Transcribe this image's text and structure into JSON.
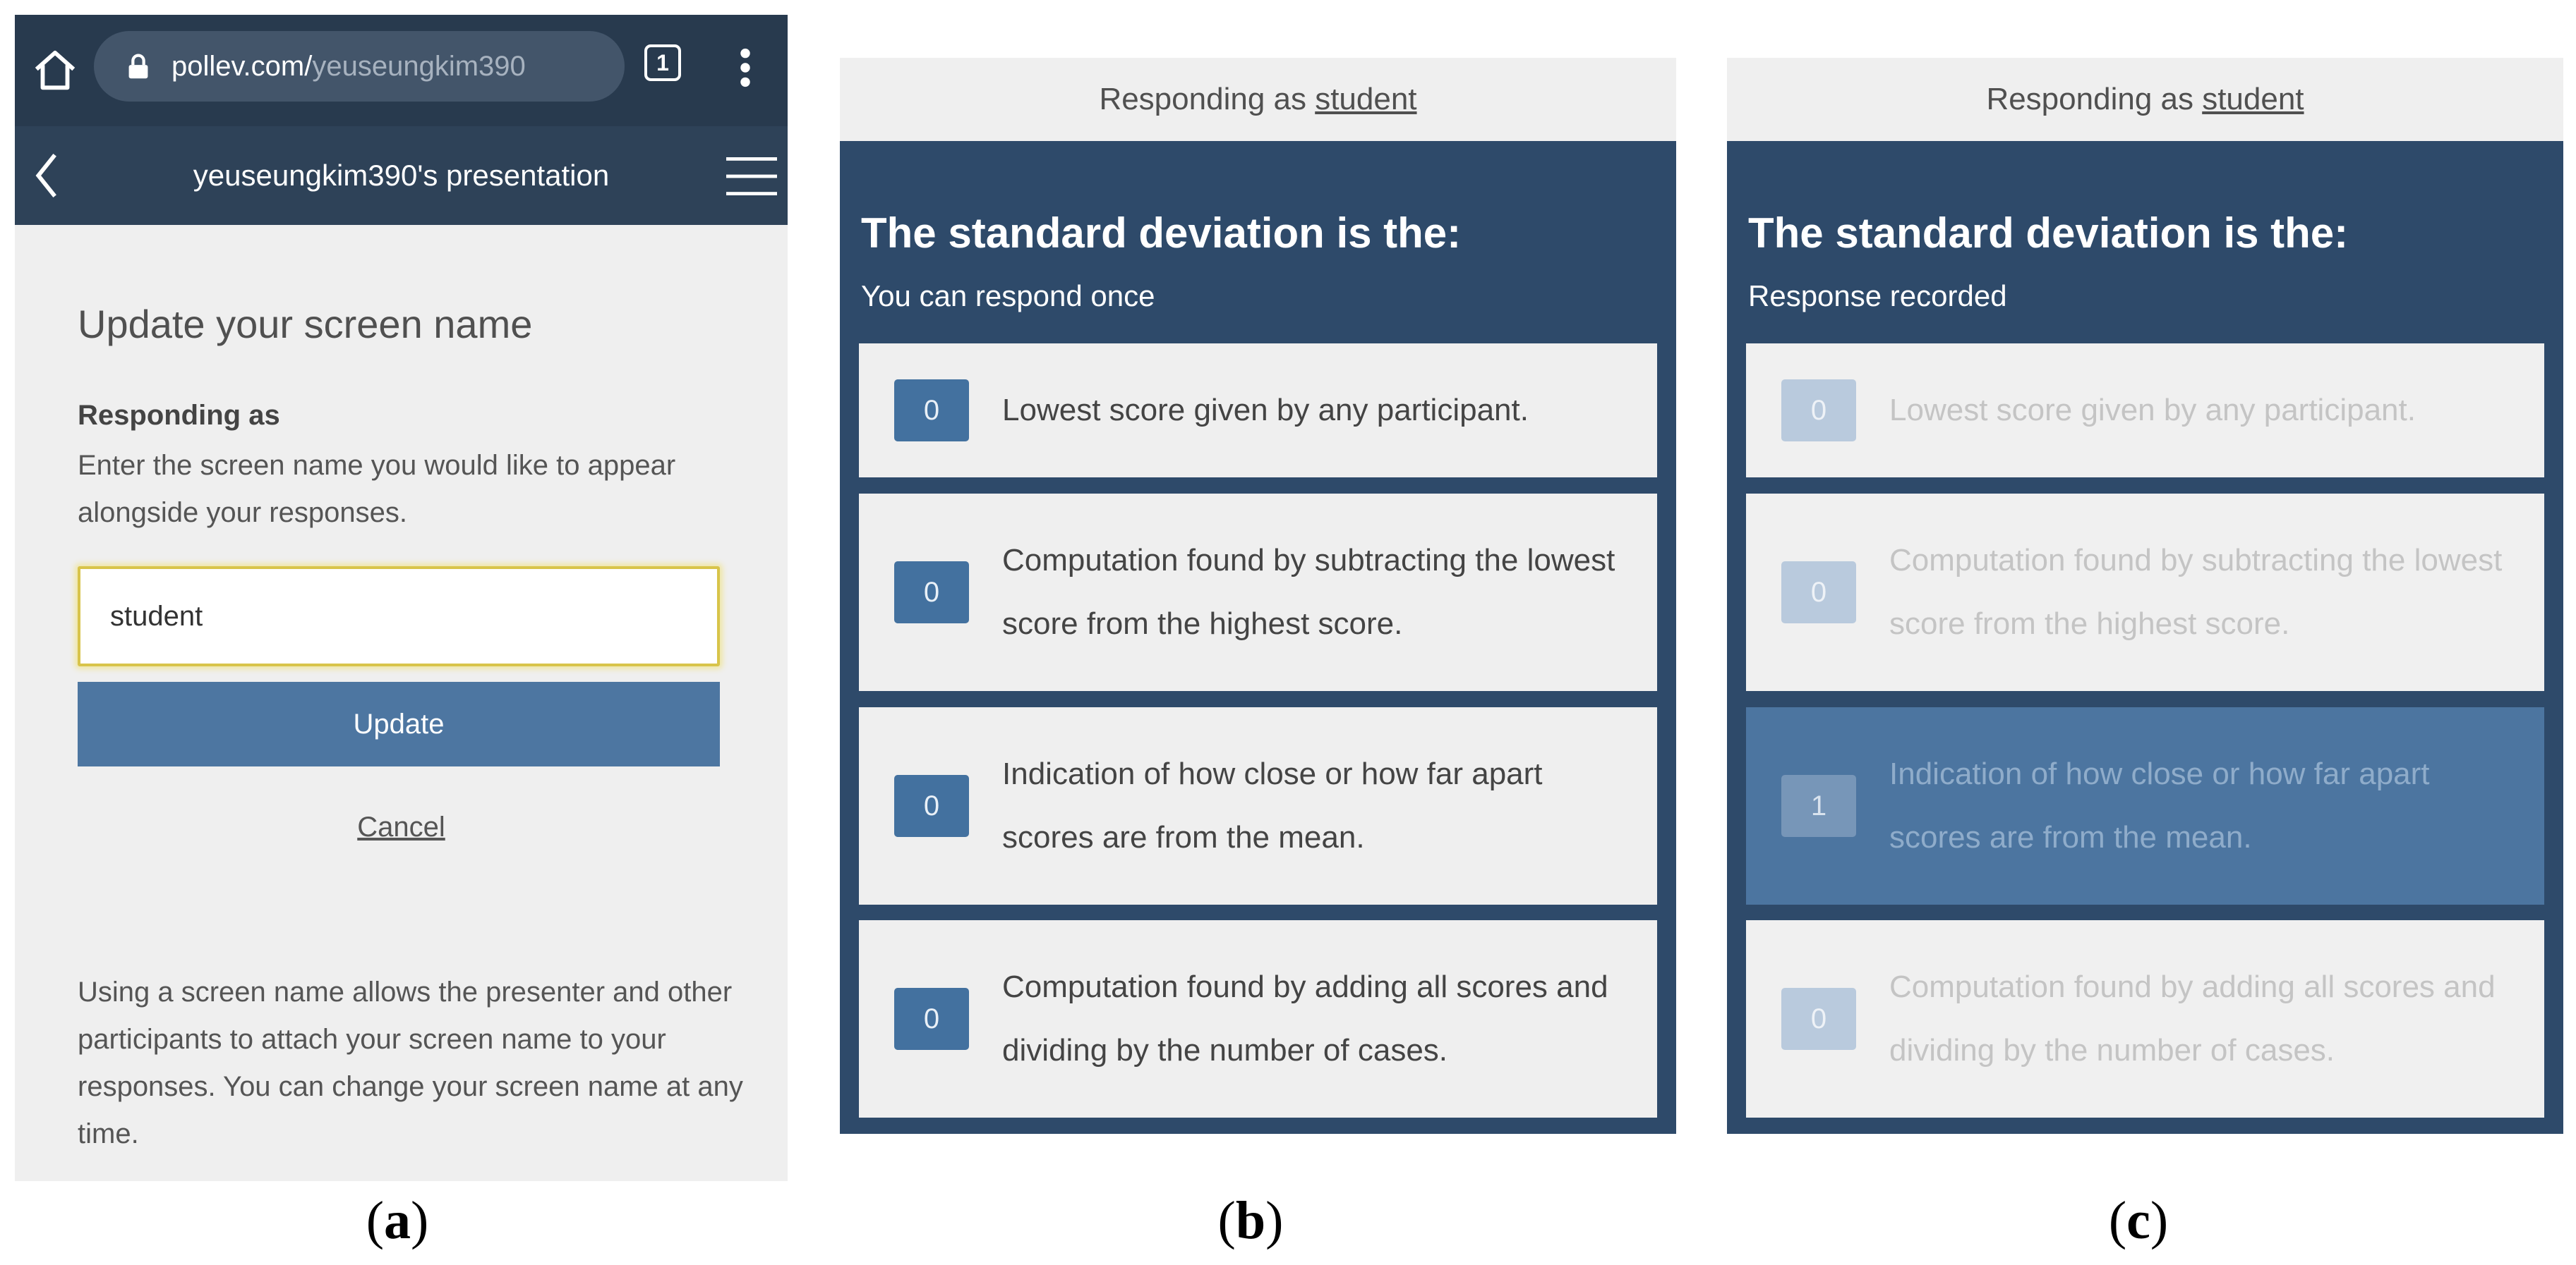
{
  "panel_a": {
    "browser": {
      "url_host": "pollev.com/",
      "url_path": "yeuseungkim390",
      "tab_count": "1",
      "icons": [
        "home-icon",
        "lock-icon",
        "tabs-icon",
        "more-vert-icon"
      ]
    },
    "app_title": "yeuseungkim390's presentation",
    "heading": "Update your screen name",
    "responding_label": "Responding as",
    "instructions": "Enter the screen name you would like to appear alongside your responses.",
    "input_value": "student",
    "update_label": "Update",
    "cancel_label": "Cancel",
    "footer_text": "Using a screen name allows the presenter and other participants to attach your screen name to your responses. You can change your screen name at any time.",
    "colors": {
      "browser_bar": "#283a4e",
      "title_bar": "#2e4258",
      "button": "#4d76a1",
      "input_border": "#d8c44a"
    }
  },
  "panel_b": {
    "responding_prefix": "Responding as ",
    "responding_name": "student",
    "question": "The standard deviation is the:",
    "status": "You can respond once",
    "options": [
      {
        "count": "0",
        "text": "Lowest score given by any participant."
      },
      {
        "count": "0",
        "text": "Computation found by subtracting the lowest score from the highest score."
      },
      {
        "count": "0",
        "text": "Indication of how close or how far apart scores are from the mean."
      },
      {
        "count": "0",
        "text": "Computation found by adding all scores and dividing by the number of cases."
      }
    ]
  },
  "panel_c": {
    "responding_prefix": "Responding as ",
    "responding_name": "student",
    "question": "The standard deviation is the:",
    "status": "Response recorded",
    "selected_index": 2,
    "options": [
      {
        "count": "0",
        "text": "Lowest score given by any participant."
      },
      {
        "count": "0",
        "text": "Computation found by subtracting the lowest score from the highest score."
      },
      {
        "count": "1",
        "text": "Indication of how close or how far apart scores are from the mean."
      },
      {
        "count": "0",
        "text": "Computation found by adding all scores and dividing by the number of cases."
      }
    ]
  },
  "captions": {
    "a": "a",
    "b": "b",
    "c": "c"
  },
  "colors": {
    "poll_background": "#2e4a6a",
    "count_box": "#43719f",
    "selected_option": "#4c75a0"
  }
}
